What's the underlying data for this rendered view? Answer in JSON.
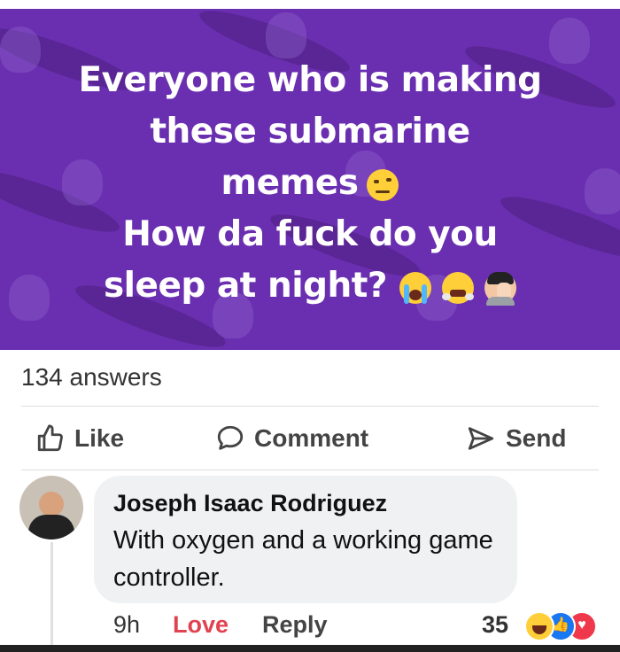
{
  "post": {
    "banner_lines": [
      "Everyone who is making",
      "these submarine",
      "memes",
      "How da fuck do you",
      "sleep at night?"
    ],
    "emojis": [
      "raised-eyebrow-face-icon",
      "loudly-crying-face-icon",
      "face-with-steam-icon",
      "facepalm-person-icon"
    ],
    "answers_count": "134 answers"
  },
  "actions": {
    "like": "Like",
    "comment": "Comment",
    "send": "Send"
  },
  "comment": {
    "author": "Joseph Isaac Rodriguez",
    "text": "With oxygen and a working game controller.",
    "time": "9h",
    "love_label": "Love",
    "reply_label": "Reply",
    "reaction_count": "35",
    "reactions": [
      "haha-reaction-icon",
      "like-reaction-icon",
      "love-reaction-icon"
    ]
  },
  "colors": {
    "banner": "#6a2fb0",
    "love": "#e0434f",
    "like_blue": "#1877f2"
  }
}
